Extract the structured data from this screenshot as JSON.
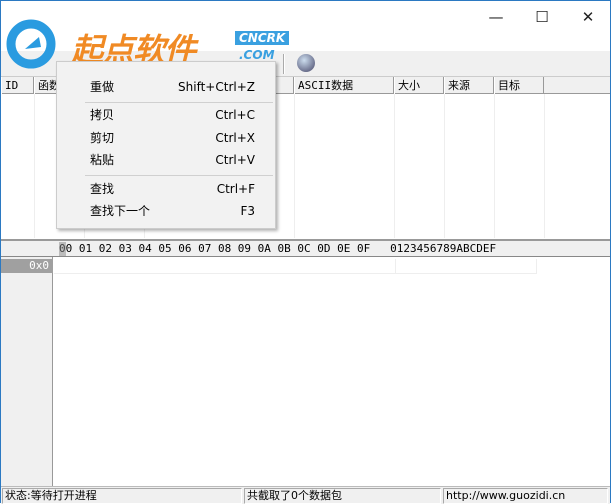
{
  "window": {
    "controls": [
      "minimize",
      "maximize",
      "close"
    ]
  },
  "logo": {
    "text": "起点软件",
    "badge_top": "CNCRK",
    "badge_bottom": ".COM"
  },
  "list": {
    "columns": [
      "ID",
      "函数",
      "",
      "",
      "ASCII数据",
      "大小",
      "来源",
      "目标"
    ]
  },
  "hex": {
    "header": "00 01 02 03 04 05 06 07 08 09 0A 0B 0C 0D 0E 0F   0123456789ABCDEF",
    "rows": [
      "0x0"
    ]
  },
  "menu": {
    "items": [
      {
        "label": "重做",
        "shortcut": "Shift+Ctrl+Z"
      },
      {
        "label": "拷贝",
        "shortcut": "Ctrl+C"
      },
      {
        "label": "剪切",
        "shortcut": "Ctrl+X"
      },
      {
        "label": "粘贴",
        "shortcut": "Ctrl+V"
      },
      {
        "label": "查找",
        "shortcut": "Ctrl+F"
      },
      {
        "label": "查找下一个",
        "shortcut": "F3"
      }
    ]
  },
  "status": {
    "state": "状态:等待打开进程",
    "count": "共截取了0个数据包",
    "url": "http://www.guozidi.cn"
  }
}
